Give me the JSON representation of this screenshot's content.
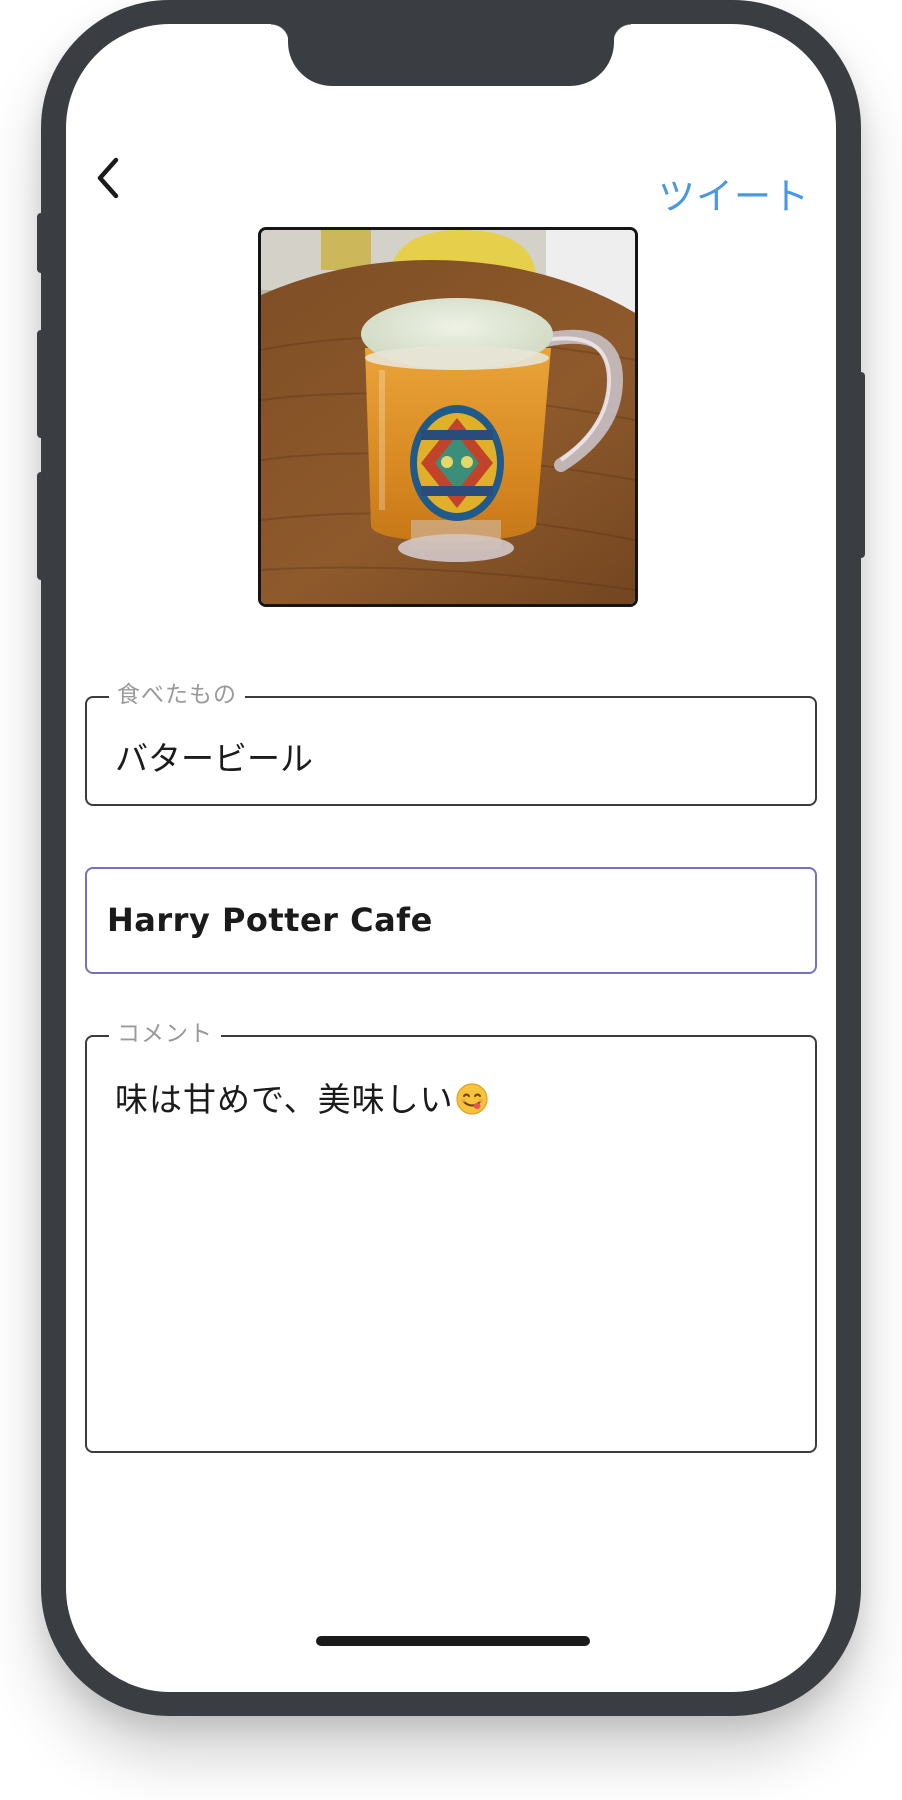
{
  "header": {
    "back_icon": "chevron-left-icon",
    "tweet_label": "ツイート",
    "accent_color": "#4a97e6"
  },
  "photo": {
    "subject": "butterbeer-mug"
  },
  "form": {
    "food": {
      "label": "食べたもの",
      "value": "バタービール"
    },
    "place": {
      "value": "Harry Potter Cafe",
      "focused_border_color": "#7470c6"
    },
    "comment": {
      "label": "コメント",
      "value": "味は甘めで、美味しい",
      "emoji": "yum-face-emoji"
    }
  }
}
